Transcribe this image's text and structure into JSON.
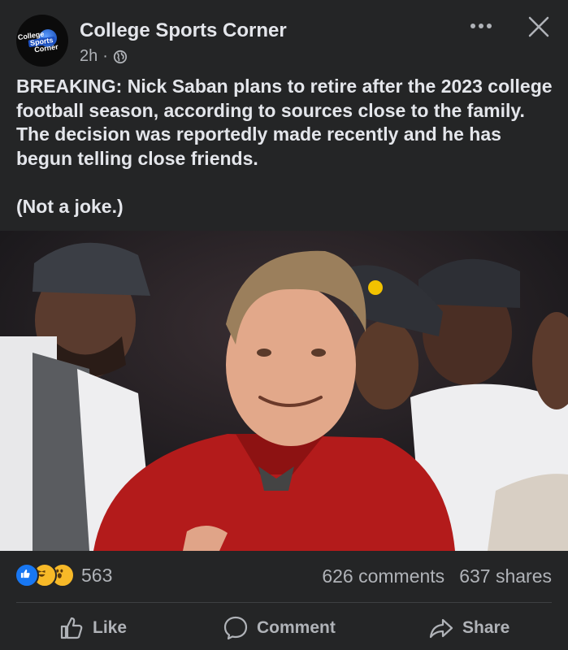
{
  "post": {
    "page_name": "College Sports Corner",
    "time": "2h",
    "separator": "·",
    "avatar_text": [
      "College",
      "Sports",
      "Corner"
    ],
    "text": "BREAKING: Nick Saban plans to retire after the 2023 college football season, according to sources close to the family. The decision was reportedly made recently and he has begun telling close friends.\n\n(Not a joke.)"
  },
  "engagement": {
    "reaction_count": "563",
    "comments": "626 comments",
    "shares": "637 shares"
  },
  "actions": {
    "like": "Like",
    "comment": "Comment",
    "share": "Share"
  },
  "icons": [
    "globe-icon",
    "more-icon",
    "close-icon",
    "like-reaction-icon",
    "haha-reaction-icon",
    "wow-reaction-icon",
    "thumbs-up-icon",
    "comment-bubble-icon",
    "share-arrow-icon"
  ],
  "colors": {
    "background": "#242526",
    "text": "#e4e6eb",
    "secondary": "#b0b3b8",
    "like_blue": "#1877f2"
  }
}
